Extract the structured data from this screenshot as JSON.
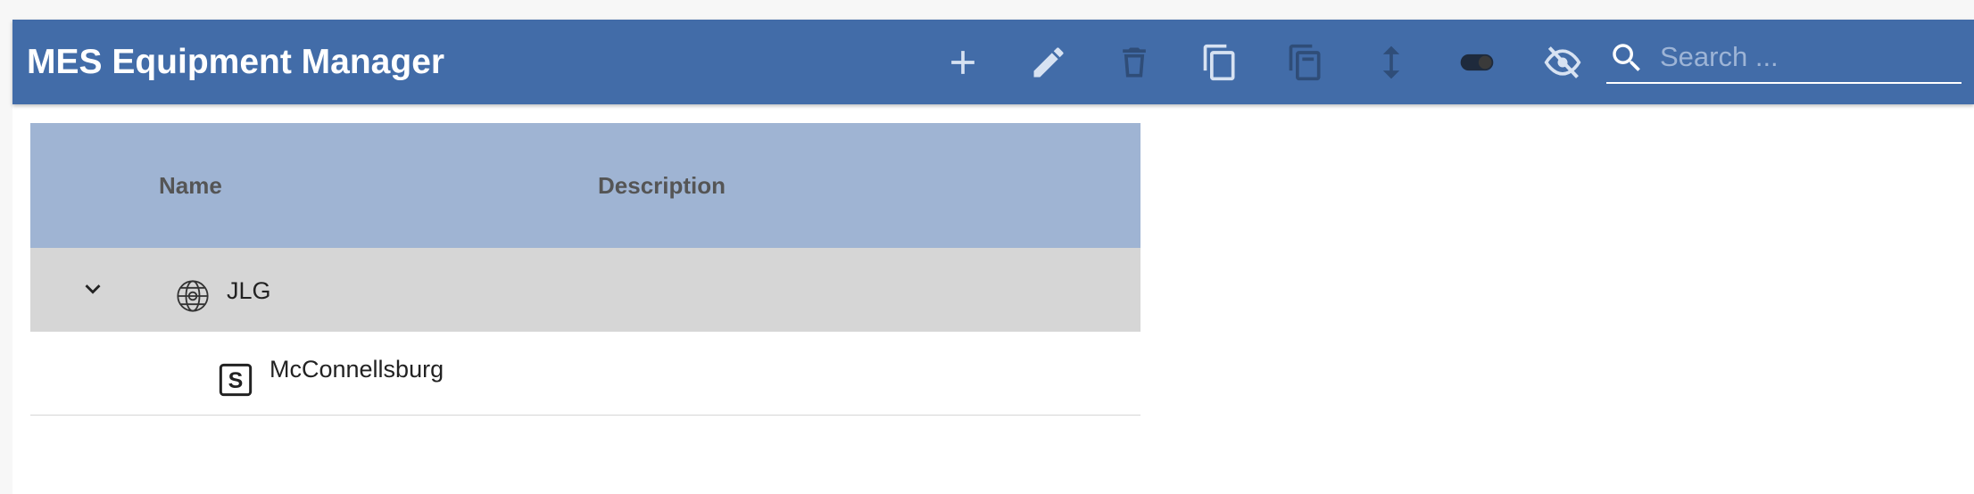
{
  "app": {
    "title": "MES Equipment Manager"
  },
  "toolbar": {
    "buttons": [
      {
        "icon": "add-icon"
      },
      {
        "icon": "edit-icon"
      },
      {
        "icon": "delete-icon"
      },
      {
        "icon": "copy-icon"
      },
      {
        "icon": "paste-icon"
      },
      {
        "icon": "move-icon"
      },
      {
        "icon": "toggle-icon"
      },
      {
        "icon": "hide-icon"
      }
    ],
    "search": {
      "placeholder": "Search ...",
      "value": ""
    }
  },
  "grid": {
    "columns": [
      "Name",
      "Description"
    ],
    "rows": [
      {
        "name": "JLG",
        "description": "",
        "icon": "globe-icon",
        "expanded": true,
        "selected": true
      },
      {
        "name": "McConnellsburg",
        "description": "",
        "icon": "site-s-icon",
        "expanded": false,
        "selected": false
      }
    ]
  },
  "colors": {
    "appbar": "#426ca8",
    "header": "#9fb4d3",
    "selected_row": "#d6d6d6",
    "icon_enabled": "#ffffff",
    "icon_disabled": "#2f4d78"
  }
}
